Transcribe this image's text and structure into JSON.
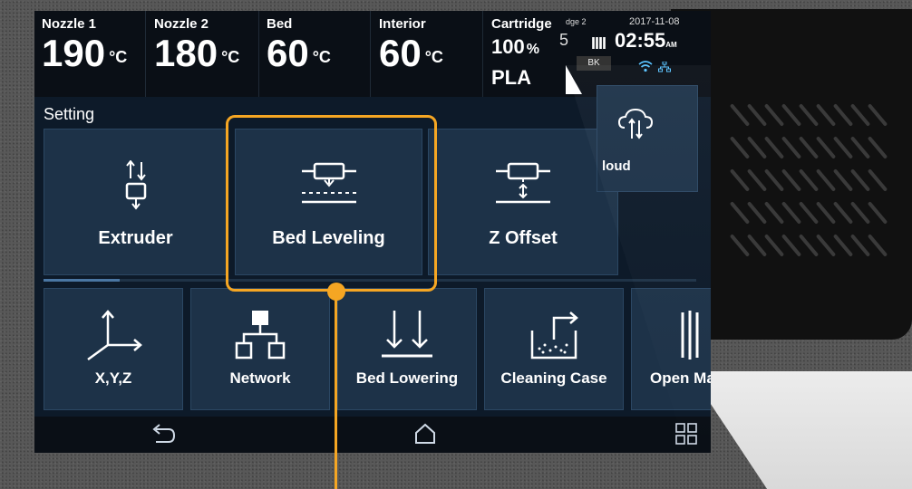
{
  "status": {
    "nozzle1": {
      "label": "Nozzle 1",
      "value": "190",
      "unit": "°C"
    },
    "nozzle2": {
      "label": "Nozzle 2",
      "value": "180",
      "unit": "°C"
    },
    "bed": {
      "label": "Bed",
      "value": "60",
      "unit": "°C"
    },
    "interior": {
      "label": "Interior",
      "value": "60",
      "unit": "°C"
    },
    "cartridge": {
      "label": "Cartridge",
      "value": "100",
      "unit": "%",
      "material": "PLA"
    },
    "cartridge2": {
      "tag": "dge 2",
      "num": "5",
      "color": "BK"
    },
    "date": "2017-11-08",
    "time": "02:55",
    "ampm": "AM"
  },
  "section_title": "Setting",
  "settings_row1": [
    {
      "label": "Extruder"
    },
    {
      "label": "Bed Leveling"
    },
    {
      "label": "Z Offset"
    }
  ],
  "cloud_label": "loud",
  "settings_row2": [
    {
      "label": "X,Y,Z"
    },
    {
      "label": "Network"
    },
    {
      "label": "Bed Lowering"
    },
    {
      "label": "Cleaning Case"
    },
    {
      "label": "Open Ma"
    }
  ],
  "colors": {
    "highlight": "#f5a623",
    "tile_bg": "#1d3248",
    "screen_bg": "#0d1a29",
    "accent_blue": "#59c3ff"
  }
}
